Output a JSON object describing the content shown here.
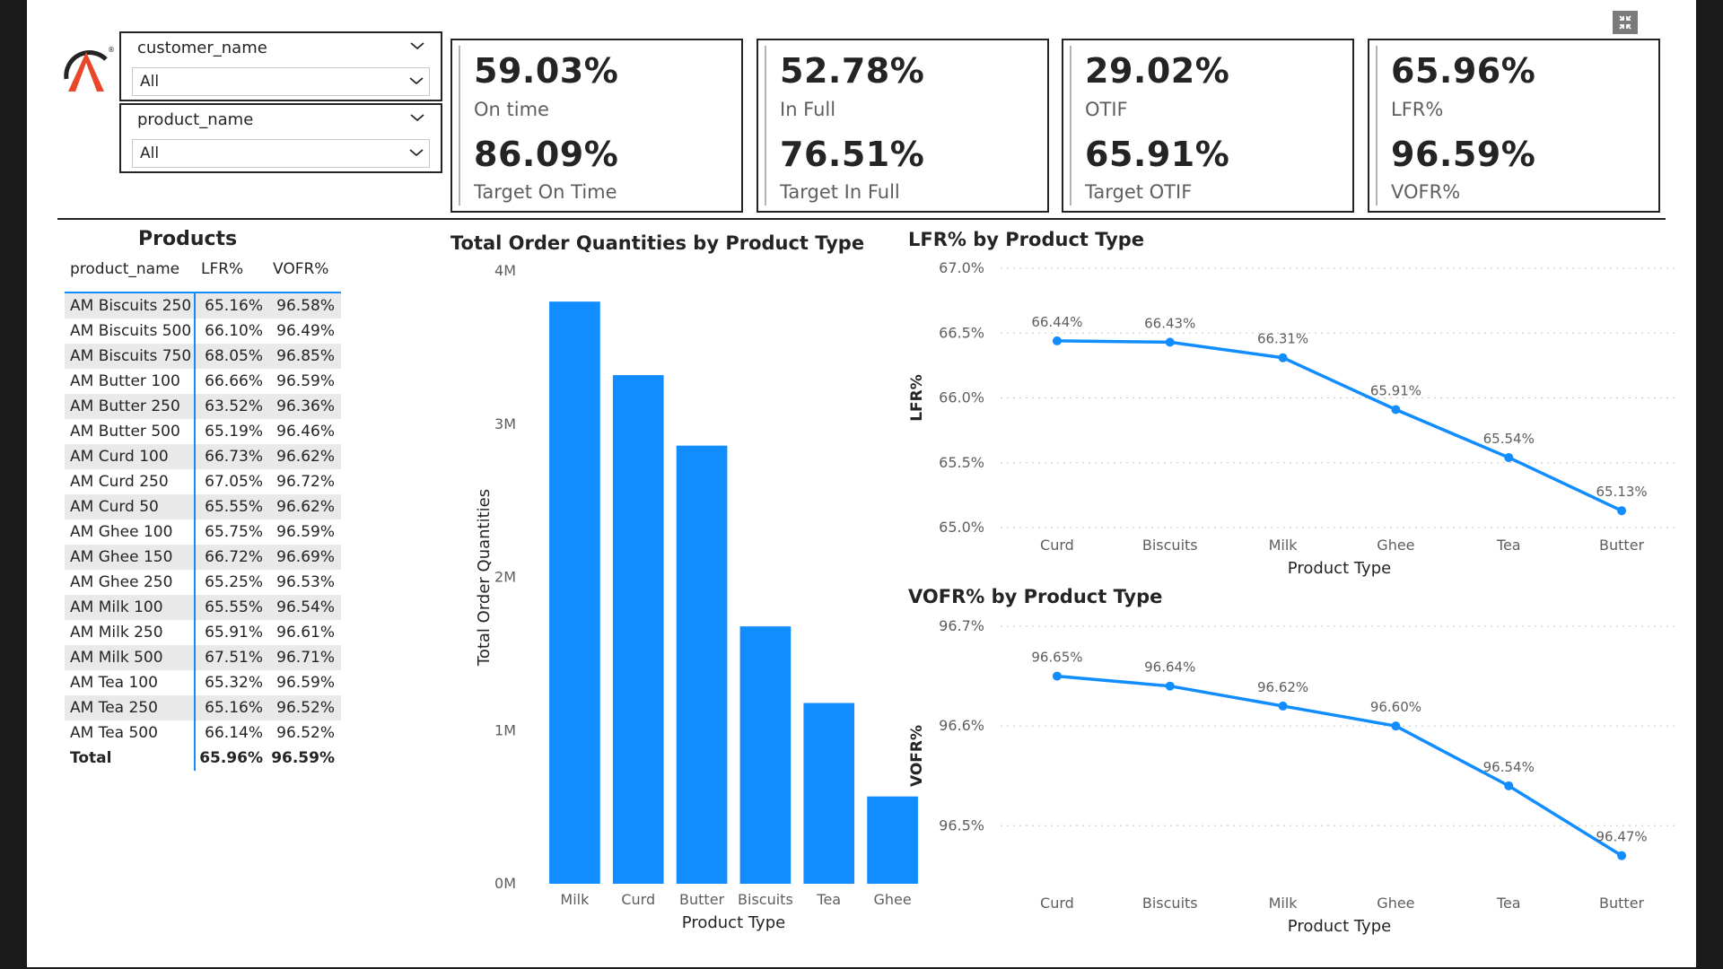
{
  "slicers": [
    {
      "title": "customer_name",
      "value": "All"
    },
    {
      "title": "product_name",
      "value": "All"
    }
  ],
  "kpis": [
    {
      "value1": "59.03%",
      "label1": "On time",
      "value2": "86.09%",
      "label2": "Target On Time"
    },
    {
      "value1": "52.78%",
      "label1": "In Full",
      "value2": "76.51%",
      "label2": "Target In Full"
    },
    {
      "value1": "29.02%",
      "label1": "OTIF",
      "value2": "65.91%",
      "label2": "Target OTIF"
    },
    {
      "value1": "65.96%",
      "label1": "LFR%",
      "value2": "96.59%",
      "label2": "VOFR%"
    }
  ],
  "table": {
    "title": "Products",
    "headers": [
      "product_name",
      "LFR%",
      "VOFR%"
    ],
    "rows": [
      [
        "AM Biscuits 250",
        "65.16%",
        "96.58%"
      ],
      [
        "AM Biscuits 500",
        "66.10%",
        "96.49%"
      ],
      [
        "AM Biscuits 750",
        "68.05%",
        "96.85%"
      ],
      [
        "AM Butter 100",
        "66.66%",
        "96.59%"
      ],
      [
        "AM Butter 250",
        "63.52%",
        "96.36%"
      ],
      [
        "AM Butter 500",
        "65.19%",
        "96.46%"
      ],
      [
        "AM Curd 100",
        "66.73%",
        "96.62%"
      ],
      [
        "AM Curd 250",
        "67.05%",
        "96.72%"
      ],
      [
        "AM Curd 50",
        "65.55%",
        "96.62%"
      ],
      [
        "AM Ghee 100",
        "65.75%",
        "96.59%"
      ],
      [
        "AM Ghee 150",
        "66.72%",
        "96.69%"
      ],
      [
        "AM Ghee 250",
        "65.25%",
        "96.53%"
      ],
      [
        "AM Milk 100",
        "65.55%",
        "96.54%"
      ],
      [
        "AM Milk 250",
        "65.91%",
        "96.61%"
      ],
      [
        "AM Milk 500",
        "67.51%",
        "96.71%"
      ],
      [
        "AM Tea 100",
        "65.32%",
        "96.59%"
      ],
      [
        "AM Tea 250",
        "65.16%",
        "96.52%"
      ],
      [
        "AM Tea 500",
        "66.14%",
        "96.52%"
      ]
    ],
    "total": [
      "Total",
      "65.96%",
      "96.59%"
    ]
  },
  "colors": {
    "accent": "#118DFF",
    "text": "#252423",
    "muted": "#605e5c"
  },
  "icons": {
    "logo": "company-logo",
    "focus": "focus-mode-icon",
    "dropdown": "chevron-down-icon"
  },
  "chart_data": [
    {
      "type": "bar",
      "title": "Total Order Quantities by Product Type",
      "xlabel": "Product Type",
      "ylabel": "Total Order Quantities",
      "categories": [
        "Milk",
        "Curd",
        "Butter",
        "Biscuits",
        "Tea",
        "Ghee"
      ],
      "values": [
        3800000,
        3320000,
        2860000,
        1680000,
        1180000,
        570000
      ],
      "ylim": [
        0,
        4000000
      ],
      "yticks": [
        "0M",
        "1M",
        "2M",
        "3M",
        "4M"
      ],
      "grid": false,
      "color": "#118DFF"
    },
    {
      "type": "line",
      "title": "LFR% by Product Type",
      "xlabel": "Product Type",
      "ylabel": "LFR%",
      "categories": [
        "Curd",
        "Biscuits",
        "Milk",
        "Ghee",
        "Tea",
        "Butter"
      ],
      "values": [
        66.44,
        66.43,
        66.31,
        65.91,
        65.54,
        65.13
      ],
      "labels": [
        "66.44%",
        "66.43%",
        "66.31%",
        "65.91%",
        "65.54%",
        "65.13%"
      ],
      "ylim": [
        65.0,
        67.0
      ],
      "yticks": [
        "65.0%",
        "65.5%",
        "66.0%",
        "66.5%",
        "67.0%"
      ],
      "grid": true,
      "color": "#118DFF"
    },
    {
      "type": "line",
      "title": "VOFR% by Product Type",
      "xlabel": "Product Type",
      "ylabel": "VOFR%",
      "categories": [
        "Curd",
        "Biscuits",
        "Milk",
        "Ghee",
        "Tea",
        "Butter"
      ],
      "values": [
        96.65,
        96.64,
        96.62,
        96.6,
        96.54,
        96.47
      ],
      "labels": [
        "96.65%",
        "96.64%",
        "96.62%",
        "96.60%",
        "96.54%",
        "96.47%"
      ],
      "ylim": [
        96.44,
        96.7
      ],
      "ytick_values": [
        96.5,
        96.6,
        96.7
      ],
      "yticks": [
        "96.5%",
        "96.6%",
        "96.7%"
      ],
      "grid": true,
      "color": "#118DFF"
    }
  ]
}
